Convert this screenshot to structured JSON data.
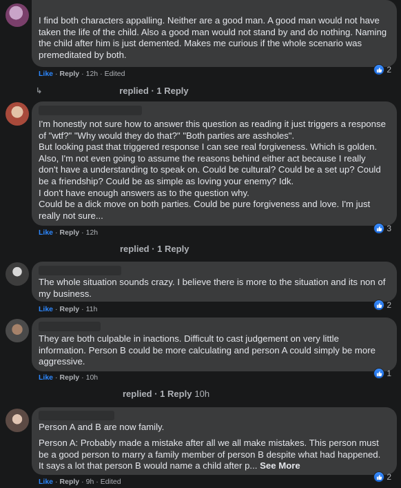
{
  "comments": [
    {
      "text": "I find both characters appalling. Neither are a good man. A good man would not have taken the life of the child. Also a good man would not stand by and do nothing. Naming the child after him is just demented. Makes me curious if the whole scenario was premeditated by both.",
      "like": "Like",
      "reply": "Reply",
      "time": "12h",
      "edited": "Edited",
      "reactions": "2",
      "replies_label": "replied · 1 Reply",
      "replies_time": ""
    },
    {
      "text": "I'm honestly not sure how to answer this question as reading it just triggers a response of \"wtf?\" \"Why would they do that?\" \"Both parties are assholes\".\nBut looking past that triggered response I can see real forgiveness. Which is golden.\nAlso, I'm not even going to assume the reasons behind either act because I really don't have a understanding to speak on. Could be cultural? Could be a set up? Could be a friendship? Could be as simple as loving your enemy? Idk.\nI don't have enough answers as to the question why.\nCould be a dick move on both parties. Could be pure forgiveness and love. I'm just really not sure...",
      "like": "Like",
      "reply": "Reply",
      "time": "12h",
      "reactions": "3",
      "replies_label": "replied · 1 Reply",
      "replies_time": ""
    },
    {
      "text": "The whole situation sounds crazy. I believe there is more to the situation and its non of my business.",
      "like": "Like",
      "reply": "Reply",
      "time": "11h",
      "reactions": "2"
    },
    {
      "text": "They are both culpable in inactions. Difficult to cast judgement on very little information. Person B could be more calculating and person A could simply be more aggressive.",
      "like": "Like",
      "reply": "Reply",
      "time": "10h",
      "reactions": "1",
      "replies_label": "replied · 1 Reply",
      "replies_time": "10h"
    },
    {
      "text": "Person A and B are now family.",
      "text2": "Person A: Probably made a mistake after all we all make mistakes. This person must be a good person to marry a family member of person B despite what had happened. It says a lot that person B would name a child after p...",
      "see_more": "See More",
      "like": "Like",
      "reply": "Reply",
      "time": "9h",
      "edited": "Edited",
      "reactions": "2"
    }
  ],
  "colors": {
    "background": "#18191a",
    "bubble": "#3a3b3c",
    "like": "#2d88ff",
    "muted": "#b0b3b8"
  },
  "icons": {
    "reaction": "like-thumb-icon",
    "reply_arrow": "reply-arrow-icon"
  }
}
